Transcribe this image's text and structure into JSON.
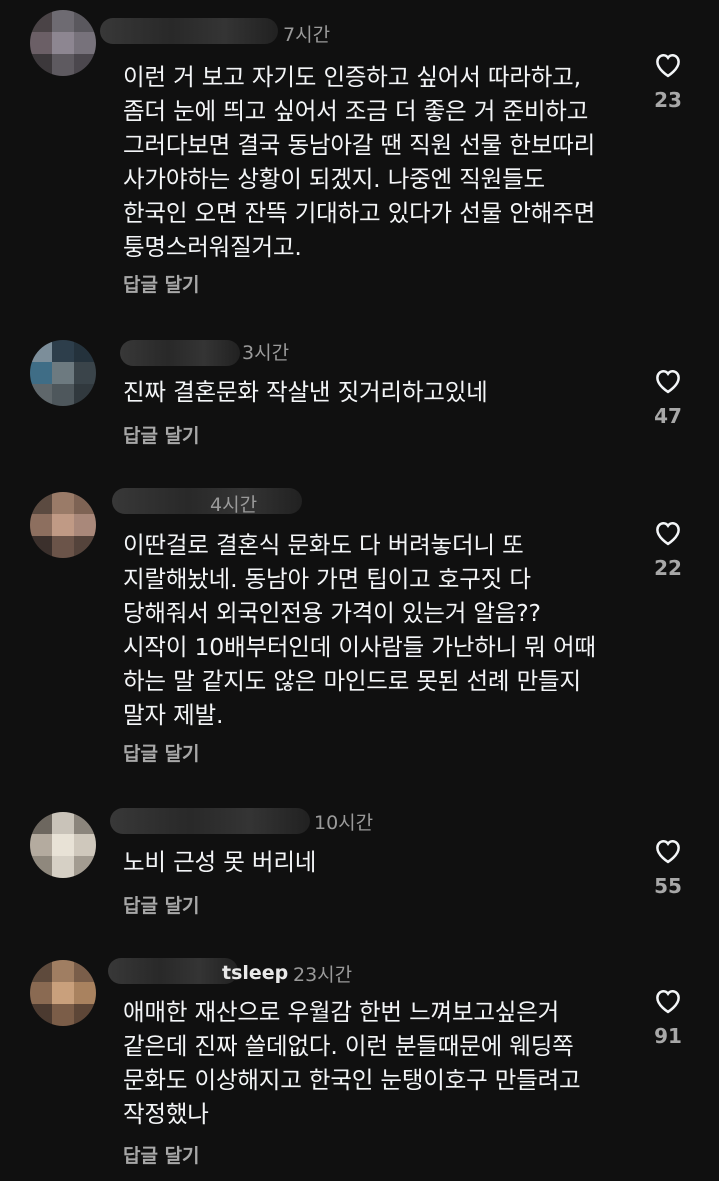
{
  "comments": [
    {
      "username_visible": "",
      "time": "7시간",
      "text": "이런 거 보고 자기도 인증하고 싶어서 따라하고,\n좀더 눈에 띄고 싶어서 조금 더 좋은 거 준비하고\n그러다보면 결국 동남아갈 땐 직원 선물 한보따리\n사가야하는 상황이 되겠지. 나중엔 직원들도\n한국인 오면 잔뜩 기대하고 있다가 선물 안해주면\n퉁명스러워질거고.",
      "reply_label": "답글 달기",
      "likes": "23"
    },
    {
      "username_visible": "",
      "time": "3시간",
      "text": "진짜 결혼문화 작살낸 짓거리하고있네",
      "reply_label": "답글 달기",
      "likes": "47"
    },
    {
      "username_visible": "",
      "time": "4시간",
      "text": "이딴걸로 결혼식 문화도 다 버려놓더니 또\n지랄해놨네. 동남아 가면 팁이고 호구짓 다\n당해줘서 외국인전용 가격이 있는거 알음??\n시작이 10배부터인데 이사람들 가난하니 뭐 어때\n하는 말 같지도 않은 마인드로 못된 선례 만들지\n말자 제발.",
      "reply_label": "답글 달기",
      "likes": "22"
    },
    {
      "username_visible": "",
      "time": "10시간",
      "text": "노비 근성 못 버리네",
      "reply_label": "답글 달기",
      "likes": "55"
    },
    {
      "username_visible": "tsleep",
      "time": "23시간",
      "text": "애매한 재산으로 우월감 한번 느껴보고싶은거\n같은데 진짜 쓸데없다. 이런 분들때문에 웨딩쪽\n문화도 이상해지고 한국인 눈탱이호구 만들려고\n작정했나",
      "reply_label": "답글 달기",
      "likes": "91"
    }
  ],
  "icons": {
    "like": "heart-outline-icon"
  },
  "colors": {
    "background": "#101010",
    "text": "#f3f5f7",
    "muted": "#a8a8a8"
  }
}
